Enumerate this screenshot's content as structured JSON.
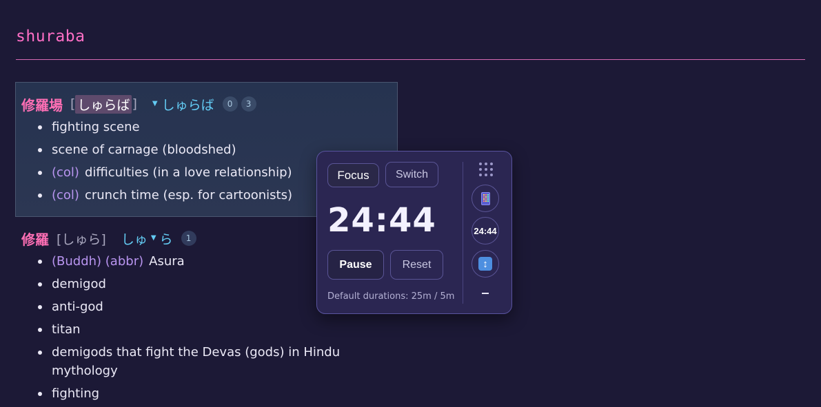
{
  "page": {
    "title": "shuraba"
  },
  "entry1": {
    "kanji": "修羅場",
    "bracket_open": "[",
    "reading": "しゅらば",
    "bracket_close": "]",
    "kana": "しゅらば",
    "badges": [
      "0",
      "3"
    ],
    "senses": [
      {
        "tag": "",
        "text": "fighting scene"
      },
      {
        "tag": "",
        "text": "scene of carnage (bloodshed)"
      },
      {
        "tag": "(col)",
        "text": "difficulties (in a love relationship)"
      },
      {
        "tag": "(col)",
        "text": "crunch time (esp. for cartoonists)"
      }
    ]
  },
  "entry2": {
    "kanji": "修羅",
    "reading_full": "[しゅら]",
    "kana_part1": "しゅ",
    "kana_part2": "ら",
    "badge": "1",
    "senses": [
      {
        "tag": "(Buddh) (abbr)",
        "text": "Asura"
      },
      {
        "tag": "",
        "text": "demigod"
      },
      {
        "tag": "",
        "text": "anti-god"
      },
      {
        "tag": "",
        "text": "titan"
      },
      {
        "tag": "",
        "text": "demigods that fight the Devas (gods) in Hindu mythology"
      },
      {
        "tag": "",
        "text": "fighting"
      }
    ]
  },
  "timer": {
    "focus_label": "Focus",
    "switch_label": "Switch",
    "time": "24:44",
    "pause_label": "Pause",
    "reset_label": "Reset",
    "defaults_text": "Default durations: 25m / 5m",
    "mini_time": "24:44",
    "icons": [
      "drag-handle-icon",
      "mobile-phone-icon",
      "up-down-arrow-icon",
      "minimize-icon"
    ]
  },
  "colors": {
    "background": "#1c1936",
    "accent_pink": "#ff6fc6",
    "kana_blue": "#63cbf3",
    "tag_purple": "#b995f0",
    "timer_bg": "#2b2652"
  }
}
